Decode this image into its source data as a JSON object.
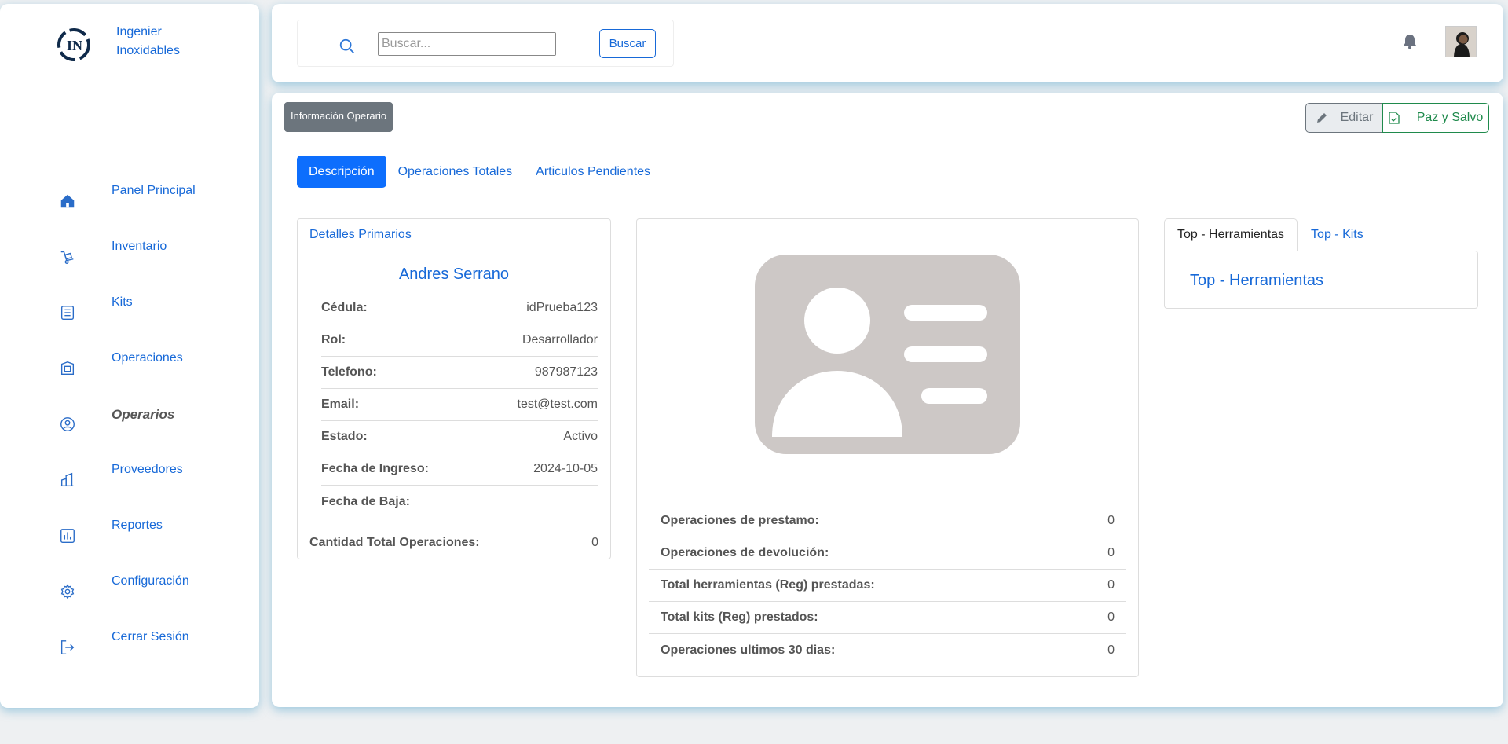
{
  "brand": {
    "name": "Ingenier Inoxidables"
  },
  "sidebar": {
    "items": [
      {
        "label": "Panel Principal",
        "icon": "home-icon",
        "active": false
      },
      {
        "label": "Inventario",
        "icon": "inventory-icon",
        "active": false
      },
      {
        "label": "Kits",
        "icon": "kits-icon",
        "active": false
      },
      {
        "label": "Operaciones",
        "icon": "operations-icon",
        "active": false
      },
      {
        "label": "Operarios",
        "icon": "user-circle-icon",
        "active": true
      },
      {
        "label": "Proveedores",
        "icon": "building-icon",
        "active": false
      },
      {
        "label": "Reportes",
        "icon": "chart-icon",
        "active": false
      },
      {
        "label": "Configuración",
        "icon": "gear-icon",
        "active": false
      },
      {
        "label": "Cerrar Sesión",
        "icon": "logout-icon",
        "active": false
      }
    ]
  },
  "search": {
    "placeholder": "Buscar...",
    "value": "",
    "button_label": "Buscar"
  },
  "header": {
    "badge": "Información Operario",
    "edit_label": "Editar",
    "paz_label": "Paz y Salvo"
  },
  "tabs": [
    {
      "label": "Descripción",
      "active": true
    },
    {
      "label": "Operaciones Totales",
      "active": false
    },
    {
      "label": "Articulos Pendientes",
      "active": false
    }
  ],
  "details": {
    "title": "Detalles Primarios",
    "name": "Andres Serrano",
    "rows": [
      {
        "label": "Cédula:",
        "value": "idPrueba123"
      },
      {
        "label": "Rol:",
        "value": "Desarrollador"
      },
      {
        "label": "Telefono:",
        "value": "987987123"
      },
      {
        "label": "Email:",
        "value": "test@test.com"
      },
      {
        "label": "Estado:",
        "value": "Activo"
      },
      {
        "label": "Fecha de Ingreso:",
        "value": "2024-10-05"
      },
      {
        "label": "Fecha de Baja:",
        "value": ""
      }
    ],
    "footer_label": "Cantidad Total Operaciones:",
    "footer_value": "0"
  },
  "stats": [
    {
      "label": "Operaciones de prestamo:",
      "value": "0"
    },
    {
      "label": "Operaciones de devolución:",
      "value": "0"
    },
    {
      "label": "Total herramientas (Reg) prestadas:",
      "value": "0"
    },
    {
      "label": "Total kits (Reg) prestados:",
      "value": "0"
    },
    {
      "label": "Operaciones ultimos 30 dias:",
      "value": "0"
    }
  ],
  "top": {
    "tabs": [
      {
        "label": "Top - Herramientas",
        "active": true
      },
      {
        "label": "Top - Kits",
        "active": false
      }
    ],
    "panel_title": "Top - Herramientas"
  },
  "colors": {
    "accent": "#1769d8",
    "primary": "#0d6efd",
    "success": "#1f8a4c",
    "secondary": "#6c757d"
  }
}
